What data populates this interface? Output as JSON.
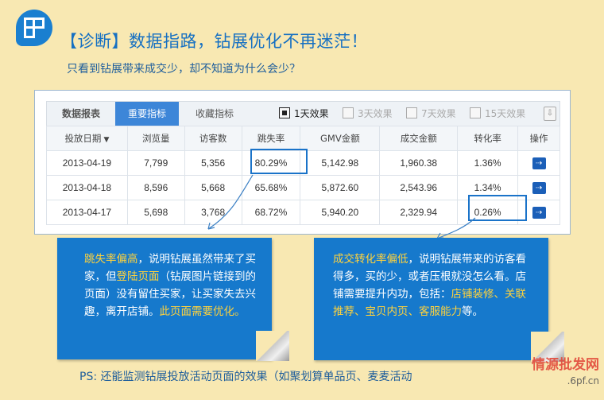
{
  "header": {
    "title": "【诊断】数据指路，钻展优化不再迷茫！",
    "subtitle": "只看到钻展带来成交少，却不知道为什么会少？"
  },
  "panel": {
    "tab_label": "数据报表",
    "tab_active": "重要指标",
    "tab_fav": "收藏指标",
    "effects": [
      "1天效果",
      "3天效果",
      "7天效果",
      "15天效果"
    ],
    "selected_effect": "1天效果",
    "columns": [
      "投放日期",
      "浏览量",
      "访客数",
      "跳失率",
      "GMV金额",
      "成交金额",
      "转化率",
      "操作"
    ],
    "rows": [
      [
        "2013-04-19",
        "7,799",
        "5,356",
        "80.29%",
        "5,142.98",
        "1,960.38",
        "1.36%"
      ],
      [
        "2013-04-18",
        "8,596",
        "5,668",
        "65.68%",
        "5,872.60",
        "2,543.96",
        "1.34%"
      ],
      [
        "2013-04-17",
        "5,698",
        "3,768",
        "68.72%",
        "5,940.20",
        "2,329.94",
        "0.26%"
      ]
    ],
    "op_icon": "details-arrow-icon"
  },
  "callout_left": {
    "p1": "跳失率偏高",
    "p2": "，说明钻展虽然带来了买家，但",
    "p3": "登陆页面",
    "p4": "（钻展图片链接到的页面）没有留住买家，让买家失去兴趣，离开店铺。",
    "p5": "此页面需要优化。"
  },
  "callout_right": {
    "p1": "成交转化率偏低",
    "p2": "，说明钻展带来的访客看得多，买的少，或者压根就没怎么看。店铺需要提升内功，包括：",
    "p3": "店铺装修、关联推荐、宝贝内页、客服能力",
    "p4": "等。"
  },
  "footer": {
    "ps": "PS: 还能监测钻展投放活动页面的效果（如聚划算单品页、麦麦活动"
  },
  "watermark": {
    "line1": "情源批发网",
    "line2": ".6pf.cn"
  },
  "colors": {
    "background": "#f8e8b2",
    "accent": "#1679cc",
    "highlight_text": "#ffd23c",
    "tab_active": "#3d86d8"
  }
}
